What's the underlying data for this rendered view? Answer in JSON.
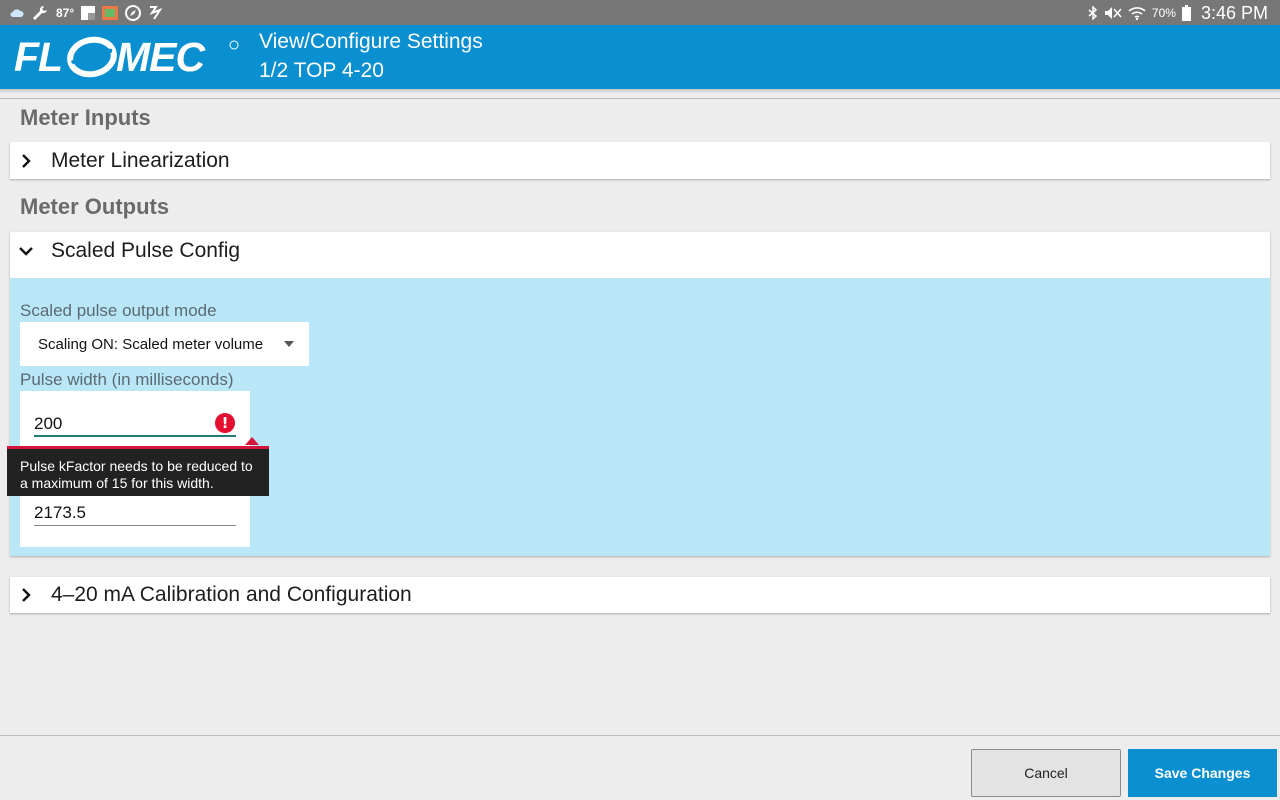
{
  "status_bar": {
    "temperature": "87°",
    "battery": "70%",
    "time": "3:46 PM"
  },
  "header": {
    "logo_text": "FLOMEC",
    "title": "View/Configure Settings",
    "subtitle": "1/2 TOP 4-20"
  },
  "sections": {
    "inputs_title": "Meter Inputs",
    "outputs_title": "Meter Outputs"
  },
  "cards": {
    "linearization": {
      "title": "Meter Linearization",
      "expanded": false
    },
    "scaled_pulse": {
      "title": "Scaled Pulse Config",
      "expanded": true
    },
    "calibration": {
      "title": "4–20 mA Calibration and Configuration",
      "expanded": false
    }
  },
  "scaled_pulse_form": {
    "mode_label": "Scaled pulse output mode",
    "mode_value": "Scaling ON: Scaled meter volume",
    "width_label": "Pulse width (in milliseconds)",
    "width_value": "200",
    "kfactor_value": "2173.5",
    "error_message": "Pulse kFactor needs to be reduced to a maximum of 15 for this width."
  },
  "buttons": {
    "cancel": "Cancel",
    "save": "Save Changes"
  },
  "colors": {
    "primary": "#0a8fd0",
    "expanded_bg": "#bae7f8",
    "error": "#e5102f"
  }
}
